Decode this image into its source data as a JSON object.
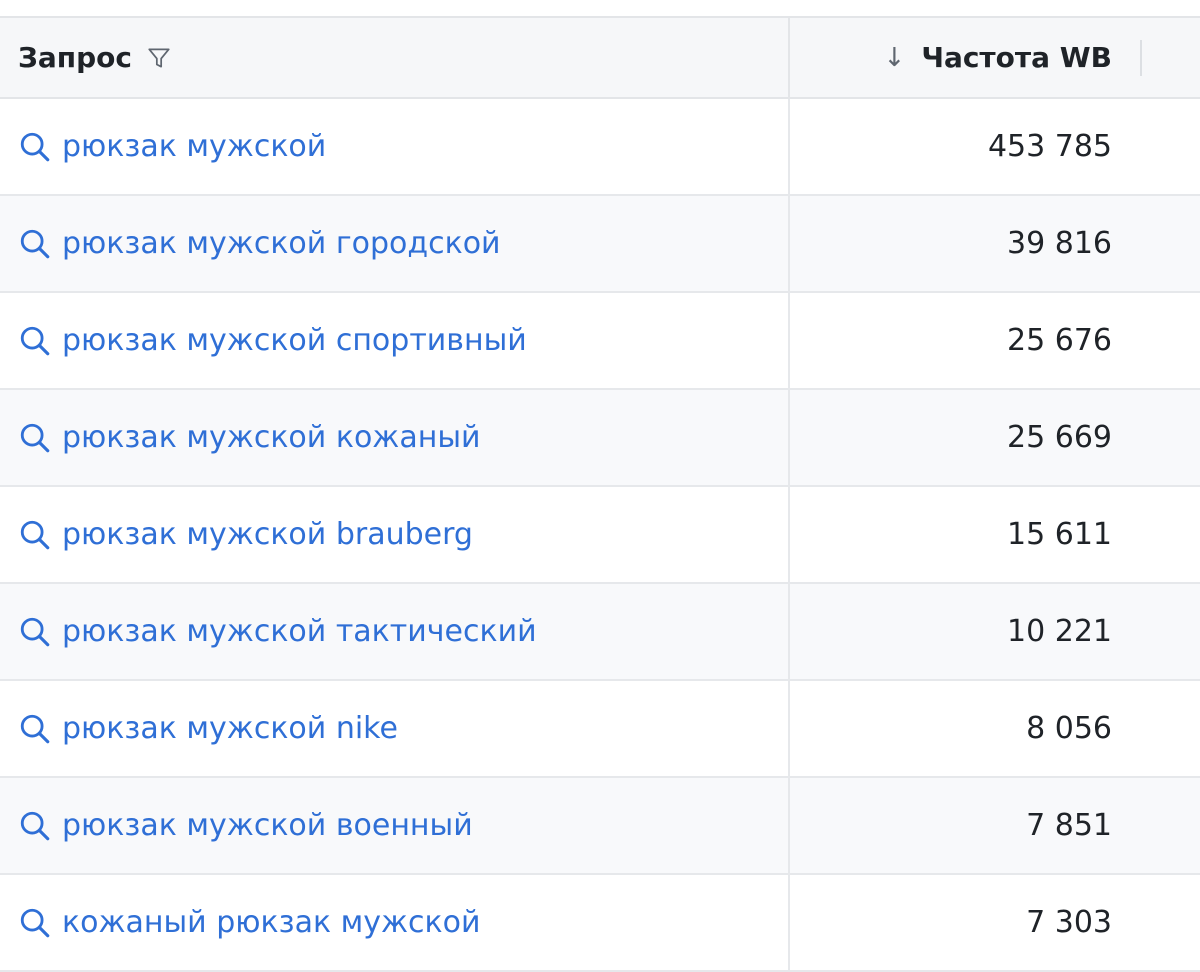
{
  "table": {
    "columns": {
      "query": "Запрос",
      "frequency": "Частота WB"
    },
    "icons": {
      "filter": "filter-icon",
      "sort": "arrow-down-icon",
      "search": "search-icon"
    },
    "sort_glyph": "↓",
    "colors": {
      "link": "#2f6fd6",
      "header_bg": "#f6f7f9",
      "alt_row_bg": "#f8f9fb",
      "border": "#e3e5e8"
    },
    "rows": [
      {
        "query": "рюкзак мужской",
        "frequency": "453 785"
      },
      {
        "query": "рюкзак мужской городской",
        "frequency": "39 816"
      },
      {
        "query": "рюкзак мужской спортивный",
        "frequency": "25 676"
      },
      {
        "query": "рюкзак мужской кожаный",
        "frequency": "25 669"
      },
      {
        "query": "рюкзак мужской brauberg",
        "frequency": "15 611"
      },
      {
        "query": "рюкзак мужской тактический",
        "frequency": "10 221"
      },
      {
        "query": "рюкзак мужской nike",
        "frequency": "8 056"
      },
      {
        "query": "рюкзак мужской военный",
        "frequency": "7 851"
      },
      {
        "query": "кожаный рюкзак мужской",
        "frequency": "7 303"
      }
    ]
  }
}
